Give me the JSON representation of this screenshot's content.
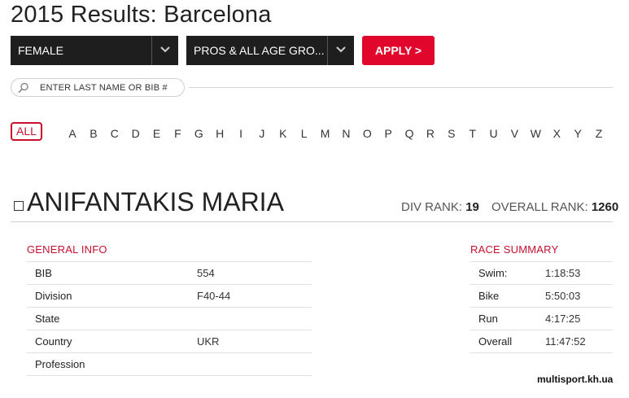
{
  "header": {
    "title": "2015 Results: Barcelona"
  },
  "filters": {
    "gender": "FEMALE",
    "division": "PROS & ALL AGE GRO...",
    "apply_label": "APPLY >"
  },
  "search": {
    "placeholder": "ENTER LAST NAME OR BIB #"
  },
  "alphabet": {
    "all_label": "ALL",
    "letters": [
      "A",
      "B",
      "C",
      "D",
      "E",
      "F",
      "G",
      "H",
      "I",
      "J",
      "K",
      "L",
      "M",
      "N",
      "O",
      "P",
      "Q",
      "R",
      "S",
      "T",
      "U",
      "V",
      "W",
      "X",
      "Y",
      "Z"
    ]
  },
  "athlete": {
    "name": "ANIFANTAKIS MARIA",
    "div_rank_label": "DIV RANK:",
    "div_rank": "19",
    "overall_rank_label": "OVERALL RANK:",
    "overall_rank": "1260"
  },
  "general_info": {
    "title": "GENERAL INFO",
    "rows": [
      {
        "label": "BIB",
        "value": "554"
      },
      {
        "label": "Division",
        "value": "F40-44"
      },
      {
        "label": "State",
        "value": ""
      },
      {
        "label": "Country",
        "value": "UKR"
      },
      {
        "label": "Profession",
        "value": ""
      }
    ]
  },
  "race_summary": {
    "title": "RACE SUMMARY",
    "rows": [
      {
        "label": "Swim:",
        "value": "1:18:53"
      },
      {
        "label": "Bike",
        "value": "5:50:03"
      },
      {
        "label": "Run",
        "value": "4:17:25"
      },
      {
        "label": "Overall",
        "value": "11:47:52"
      }
    ]
  },
  "watermark": "multisport.kh.ua",
  "colors": {
    "accent": "#e1062c",
    "dark": "#1e1e1e"
  },
  "icons": {
    "search": "magnifier-icon",
    "dropdown": "chevron-down-icon"
  }
}
